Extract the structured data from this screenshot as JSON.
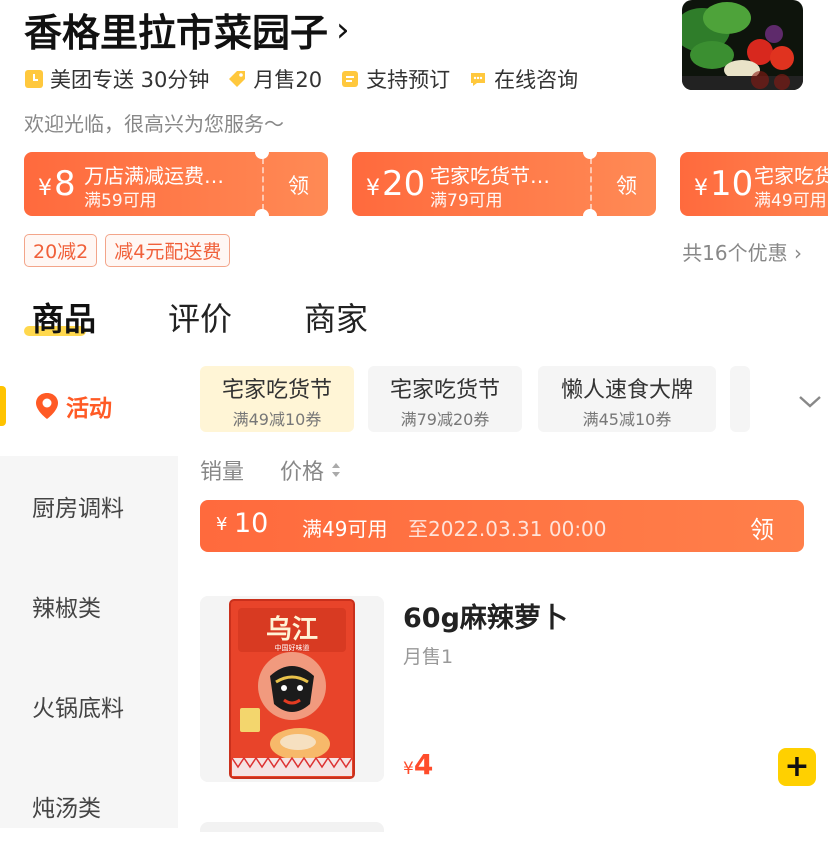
{
  "store": {
    "name": "香格里拉市菜园子",
    "chevron": "›",
    "delivery": "美团专送 30分钟",
    "monthly_sales": "月售20",
    "preorder": "支持预订",
    "consult": "在线咨询",
    "welcome": "欢迎光临，很高兴为您服务～"
  },
  "coupons": [
    {
      "currency": "¥",
      "amount": "8",
      "title": "万店满减运费…",
      "condition": "满59可用",
      "claim": "领"
    },
    {
      "currency": "¥",
      "amount": "20",
      "title": "宅家吃货节…",
      "condition": "满79可用",
      "claim": "领"
    },
    {
      "currency": "¥",
      "amount": "10",
      "title": "宅家吃货",
      "condition": "满49可用",
      "claim": ""
    }
  ],
  "promos": {
    "tags": [
      "20减2",
      "减4元配送费"
    ],
    "total": "共16个优惠",
    "chevron": "›"
  },
  "tabs": [
    "商品",
    "评价",
    "商家"
  ],
  "sidebar": [
    "活动",
    "厨房调料",
    "辣椒类",
    "火锅底料",
    "炖汤类"
  ],
  "subtabs": [
    {
      "title": "宅家吃货节",
      "sub": "满49减10券"
    },
    {
      "title": "宅家吃货节",
      "sub": "满79减20券"
    },
    {
      "title": "懒人速食大牌",
      "sub": "满45减10券"
    }
  ],
  "sort": {
    "sales": "销量",
    "price": "价格"
  },
  "store_coupon": {
    "currency": "¥",
    "amount": "10",
    "condition": "满49可用",
    "expiry": "至2022.03.31 00:00",
    "claim": "领"
  },
  "product": {
    "name": "60g麻辣萝卜",
    "sales": "月售1",
    "currency": "¥",
    "price": "4",
    "add": "+",
    "package_brand": "乌江",
    "package_sub": "中国好味道"
  },
  "colors": {
    "accent": "#ff6a3d",
    "yellow": "#ffd000",
    "active_side": "#ff5a25"
  }
}
